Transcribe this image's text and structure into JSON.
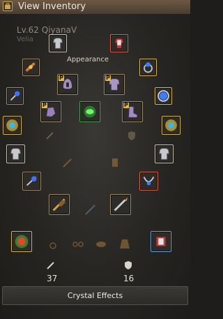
{
  "window": {
    "title": "View Inventory",
    "icon": "inventory-icon"
  },
  "character": {
    "level_name": "Lv.62 QiyanaV",
    "realm": "Velia"
  },
  "appearance": {
    "label": "Appearance"
  },
  "slots": {
    "main_weapon": "enhanced-sword-icon",
    "sub_weapon": "dagger-icon",
    "awakening": "spear-icon",
    "helmet": "helmet-icon",
    "armor": "armor-icon",
    "gloves": "gloves-icon",
    "shoes": "boots-icon",
    "necklace": "necklace-icon",
    "ring_left": "ring-icon",
    "ring_right": "ring-icon",
    "earring_left": "earring-icon",
    "earring_right": "earring-icon",
    "belt": "belt-icon",
    "alchemy_stone": "alchemy-stone-icon",
    "artifact": "artifact-icon"
  },
  "stats": {
    "attack": "37",
    "defense": "16"
  },
  "buttons": {
    "crystal_effects": "Crystal Effects"
  }
}
